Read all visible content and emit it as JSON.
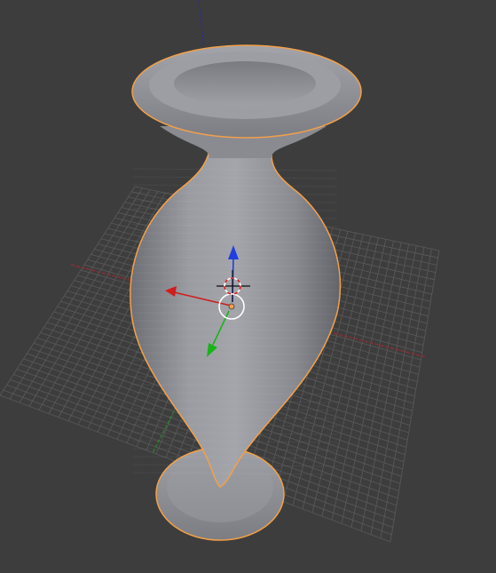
{
  "viewport": {
    "background": "#3d3d3d",
    "grid_color": "#5a5a5a",
    "x_axis_color": "#8a2f33",
    "y_axis_color": "#2f7a2f",
    "z_axis_color": "#2b2ba8",
    "selection_outline_color": "#f2a04a",
    "mesh_color": "#8f9096",
    "object": "vase",
    "selected": true
  },
  "gizmo": {
    "mode": "translate",
    "x_arrow_color": "#d01d1d",
    "y_arrow_color": "#18b418",
    "z_arrow_color": "#1f3fe0",
    "center_ring_color": "#ffffff",
    "origin_color": "#f2a04a",
    "cursor_3d": "3d-cursor-icon"
  }
}
